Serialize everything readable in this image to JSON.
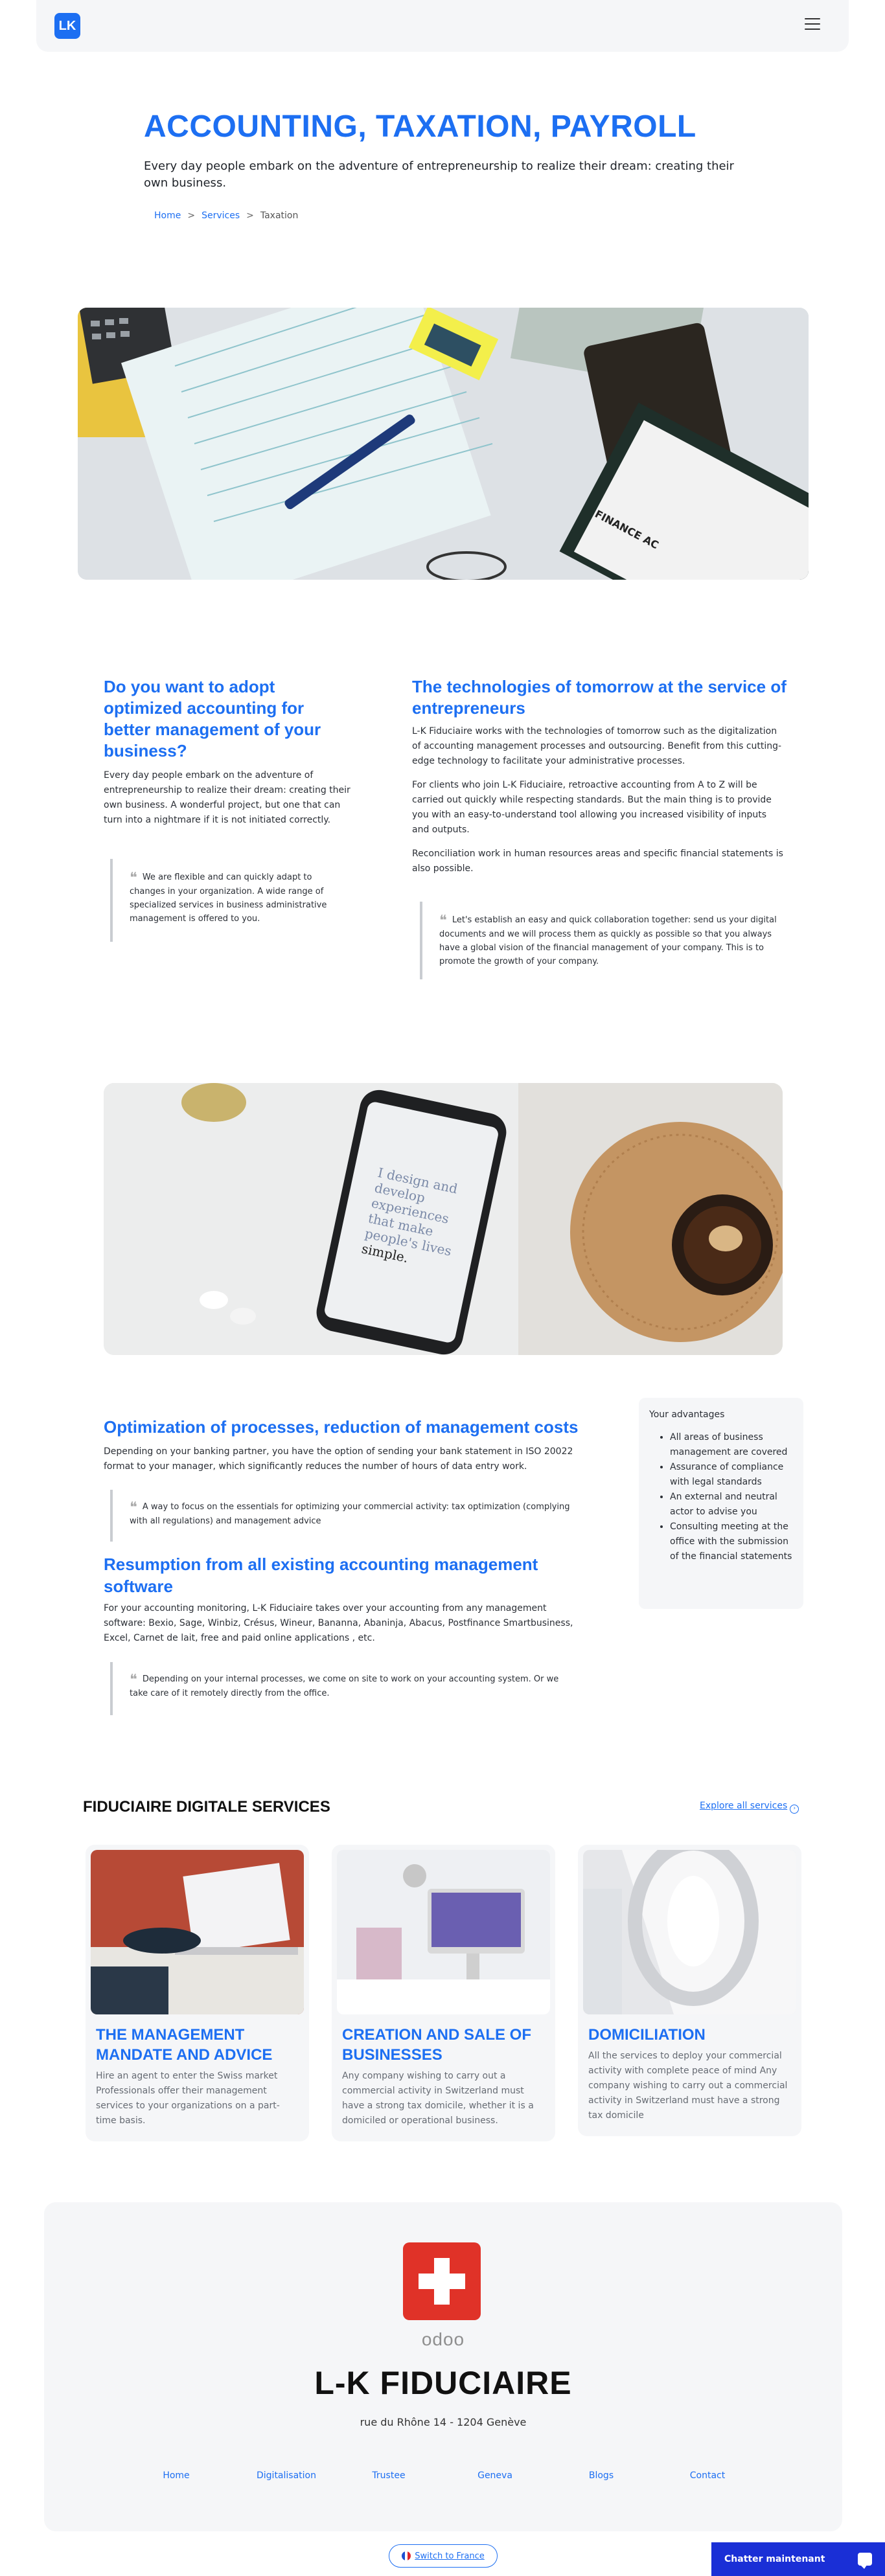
{
  "header": {
    "logo_text": "LK",
    "menu_icon": "hamburger-icon"
  },
  "hero": {
    "title": "ACCOUNTING, TAXATION, PAYROLL",
    "subtitle": "Every day people embark on the adventure of entrepreneurship to realize their dream: creating their own business.",
    "breadcrumb": {
      "home": "Home",
      "services": "Services",
      "current": "Taxation",
      "separator": ">"
    }
  },
  "intro": {
    "left": {
      "title": "Do you want to adopt optimized accounting for better management of your business?",
      "body": "Every day people embark on the adventure of entrepreneurship to realize their dream: creating their own business. A wonderful project, but one that can turn into a nightmare if it is not initiated correctly.",
      "quote": "We are flexible and can quickly adapt to changes in your organization. A wide range of specialized services in business administrative management is offered to you."
    },
    "right": {
      "title": "The technologies of tomorrow at the service of entrepreneurs",
      "p1": "L-K Fiduciaire works with the technologies of tomorrow such as the digitalization of accounting management processes and outsourcing. Benefit from this cutting-edge technology to facilitate your administrative processes.",
      "p2": "For clients who join L-K Fiduciaire, retroactive accounting from A to Z will be carried out quickly while respecting standards. But the main thing is to provide you with an easy-to-understand tool allowing you increased visibility of inputs and outputs.",
      "p3": "Reconciliation work in human resources areas and specific financial statements is also possible.",
      "quote": "Let's establish an easy and quick collaboration together: send us your digital documents and we will process them as quickly as possible so that you always have a global vision of the financial management of your company. This is to promote the growth of your company."
    }
  },
  "phone_screen": {
    "line1": "I design and",
    "line2": "develop",
    "line3": "experiences",
    "line4": "that make",
    "line5": "people's lives",
    "line6": "simple."
  },
  "optimization": {
    "title1": "Optimization of processes, reduction of management costs",
    "body1": "Depending on your banking partner, you have the option of sending your bank statement in ISO 20022 format to your manager, which significantly reduces the number of hours of data entry work.",
    "quote1": "A way to focus on the essentials for optimizing your commercial activity: tax optimization (complying with all regulations) and management advice",
    "title2": "Resumption from all existing accounting management software",
    "body2": "For your accounting monitoring, L-K Fiduciaire takes over your accounting from any management software: Bexio, Sage, Winbiz, Crésus, Wineur, Bananna, Abaninja, Abacus, Postfinance Smartbusiness, Excel, Carnet de lait, free and paid online applications , etc.",
    "quote2": "Depending on your internal processes, we come on site to work on your accounting system. Or we take care of it remotely directly from the office."
  },
  "advantages": {
    "title": "Your advantages",
    "items": [
      "All areas of business management are covered",
      "Assurance of compliance with legal standards",
      "An external and neutral actor to advise you",
      "Consulting meeting at the office with the submission of the financial statements"
    ]
  },
  "services": {
    "heading": "FIDUCIAIRE DIGITALE SERVICES",
    "explore": "Explore all services",
    "cards": [
      {
        "title": "THE MANAGEMENT MANDATE AND ADVICE",
        "text": "Hire an agent to enter the Swiss market Professionals offer their management services to your organizations on a part-time basis."
      },
      {
        "title": "CREATION AND SALE OF BUSINESSES",
        "text": "Any company wishing to carry out a commercial activity in Switzerland must have a strong tax domicile, whether it is a domiciled or operational business."
      },
      {
        "title": "DOMICILIATION",
        "text": "All the services to deploy your commercial activity with complete peace of mind Any company wishing to carry out a commercial activity in Switzerland must have a strong tax domicile"
      }
    ]
  },
  "footer": {
    "odoo": "odoo",
    "brand": "L-K FIDUCIAIRE",
    "address": "rue du Rhône 14 - 1204 Genève",
    "nav": [
      "Home",
      "Digitalisation",
      "Trustee",
      "Geneva",
      "Blogs",
      "Contact"
    ]
  },
  "switch_country": "Switch to France",
  "chat": "Chatter maintenant",
  "colors": {
    "accent": "#1d6ff2",
    "swiss_red": "#e03228",
    "chat_bg": "#1a2fd6"
  }
}
